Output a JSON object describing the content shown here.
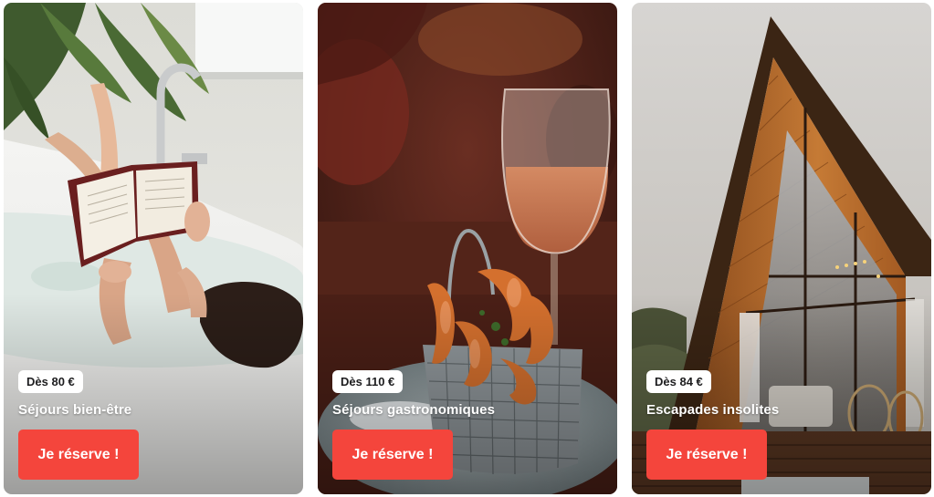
{
  "colors": {
    "cta_background": "#f4453c",
    "cta_text": "#ffffff",
    "badge_background": "#ffffff",
    "title_text": "#ffffff"
  },
  "cards": [
    {
      "price": "Dès 80 €",
      "title": "Séjours bien-être",
      "cta_label": "Je réserve !",
      "image_icon": "bathtub-reading-photo"
    },
    {
      "price": "Dès 110 €",
      "title": "Séjours gastronomiques",
      "cta_label": "Je réserve !",
      "image_icon": "shrimp-and-wine-photo"
    },
    {
      "price": "Dès 84 €",
      "title": "Escapades insolites",
      "cta_label": "Je réserve !",
      "image_icon": "a-frame-cabin-photo"
    }
  ]
}
